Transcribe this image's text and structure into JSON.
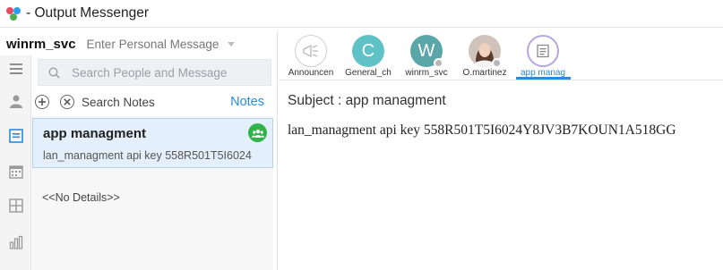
{
  "window": {
    "title": "- Output Messenger"
  },
  "status": {
    "username": "winrm_svc",
    "personal_message_placeholder": "Enter Personal Message"
  },
  "search": {
    "placeholder": "Search People and Message"
  },
  "notes_toolbar": {
    "search_label": "Search Notes",
    "notes_link": "Notes"
  },
  "notes": {
    "items": [
      {
        "title": "app managment",
        "preview": "lan_managment  api key 558R501T5I6024"
      }
    ],
    "no_details": "<<No Details>>"
  },
  "tabs": [
    {
      "label": "Announcen",
      "type": "announcement-icon"
    },
    {
      "label": "General_ch",
      "type": "letter",
      "letter": "C",
      "color": "#5fc2c6"
    },
    {
      "label": "winrm_svc",
      "type": "letter",
      "letter": "W",
      "color": "#5aa6a8"
    },
    {
      "label": "O.martinez",
      "type": "photo"
    },
    {
      "label": "app manag",
      "type": "note-icon",
      "active": true
    }
  ],
  "content": {
    "subject_label": "Subject : app managment",
    "body": "lan_managment  api key 558R501T5I6024Y8JV3B7KOUN1A518GG"
  },
  "colors": {
    "accent": "#2a8bd8",
    "badge_green": "#2fb34a",
    "selection_bg": "#e3effa"
  }
}
